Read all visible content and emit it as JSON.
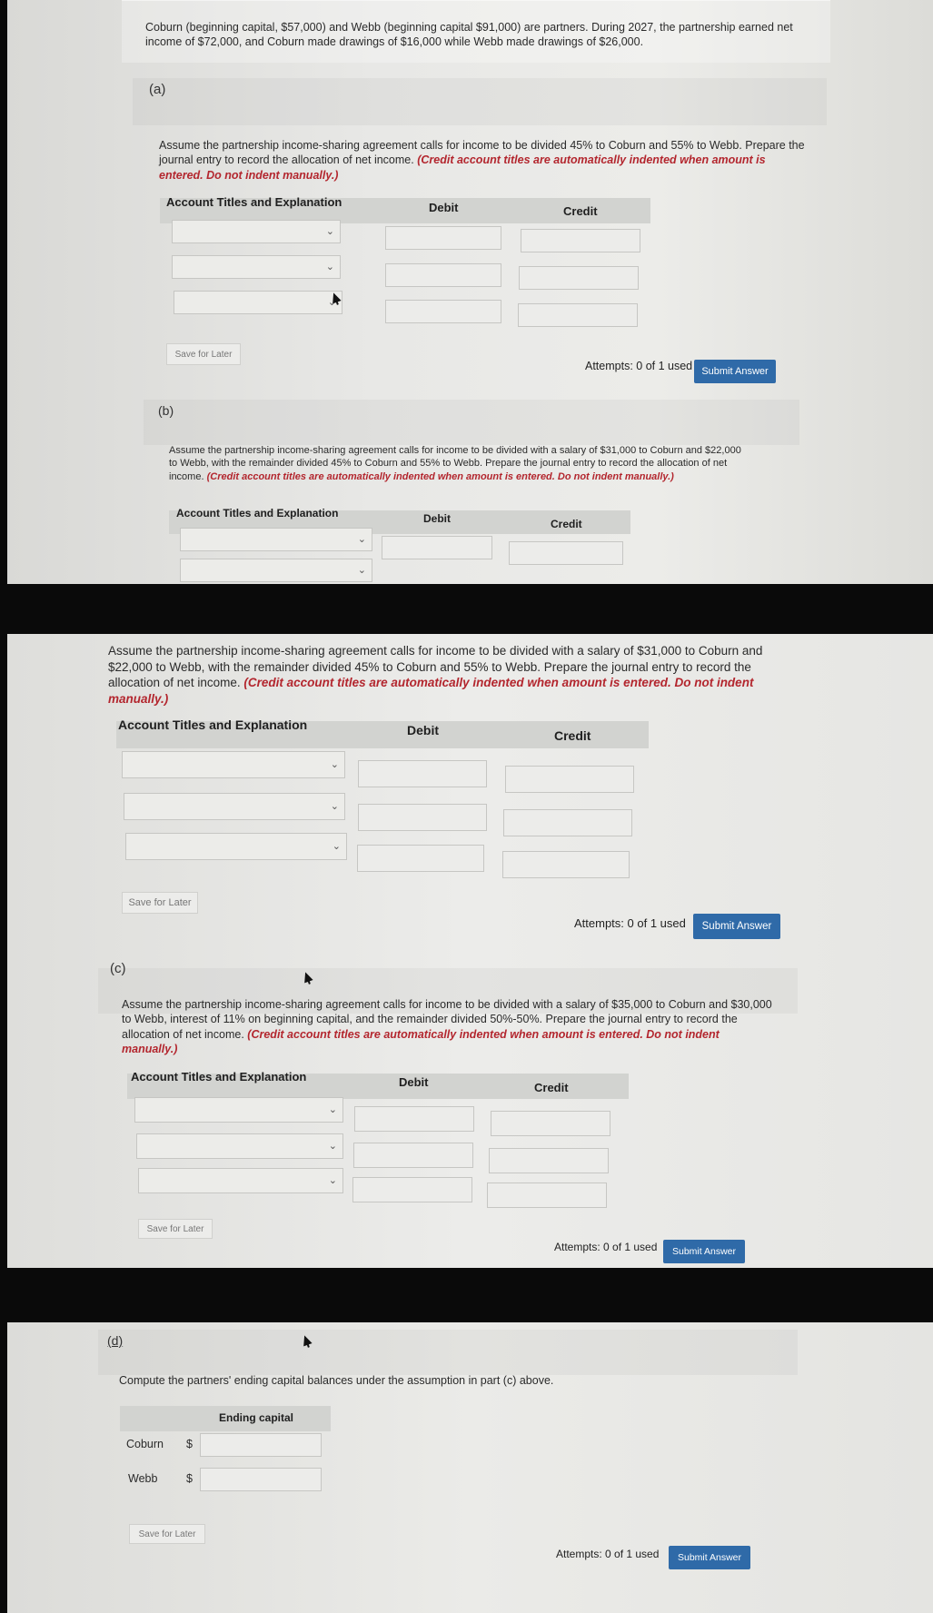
{
  "problem": {
    "intro": "Coburn (beginning capital, $57,000) and Webb (beginning capital $91,000) are partners. During 2027, the partnership earned net income of $72,000, and Coburn made drawings of $16,000 while Webb made drawings of $26,000."
  },
  "part_a": {
    "label": "(a)",
    "instruction": "Assume the partnership income-sharing agreement calls for income to be divided 45% to Coburn and 55% to Webb. Prepare the journal entry to record the allocation of net income.",
    "note": "(Credit account titles are automatically indented when amount is entered. Do not indent manually.)"
  },
  "part_b": {
    "label": "(b)",
    "instruction": "Assume the partnership income-sharing agreement calls for income to be divided with a salary of $31,000 to Coburn and $22,000 to Webb, with the remainder divided 45% to Coburn and 55% to Webb. Prepare the journal entry to record the allocation of net income.",
    "note": "(Credit account titles are automatically indented when amount is entered. Do not indent manually.)"
  },
  "part_c": {
    "label": "(c)",
    "instruction": "Assume the partnership income-sharing agreement calls for income to be divided with a salary of $35,000 to Coburn and $30,000 to Webb, interest of 11% on beginning capital, and the remainder divided 50%-50%. Prepare the journal entry to record the allocation of net income.",
    "note": "(Credit account titles are automatically indented when amount is entered. Do not indent manually.)"
  },
  "part_d": {
    "label": "(d)",
    "instruction": "Compute the partners' ending capital balances under the assumption in part (c) above.",
    "column_header": "Ending capital",
    "rows": [
      {
        "name": "Coburn",
        "currency": "$"
      },
      {
        "name": "Webb",
        "currency": "$"
      }
    ]
  },
  "table": {
    "col_account": "Account Titles and Explanation",
    "col_debit": "Debit",
    "col_credit": "Credit"
  },
  "controls": {
    "save_label": "Save for Later",
    "attempts": "Attempts: 0 of 1 used",
    "submit_label": "Submit Answer"
  },
  "icons": {
    "dropdown": "chevron-down-icon",
    "pointer": "mouse-pointer-icon"
  },
  "colors": {
    "submit_bg": "#2f6aa8",
    "note_red": "#b3262e"
  }
}
